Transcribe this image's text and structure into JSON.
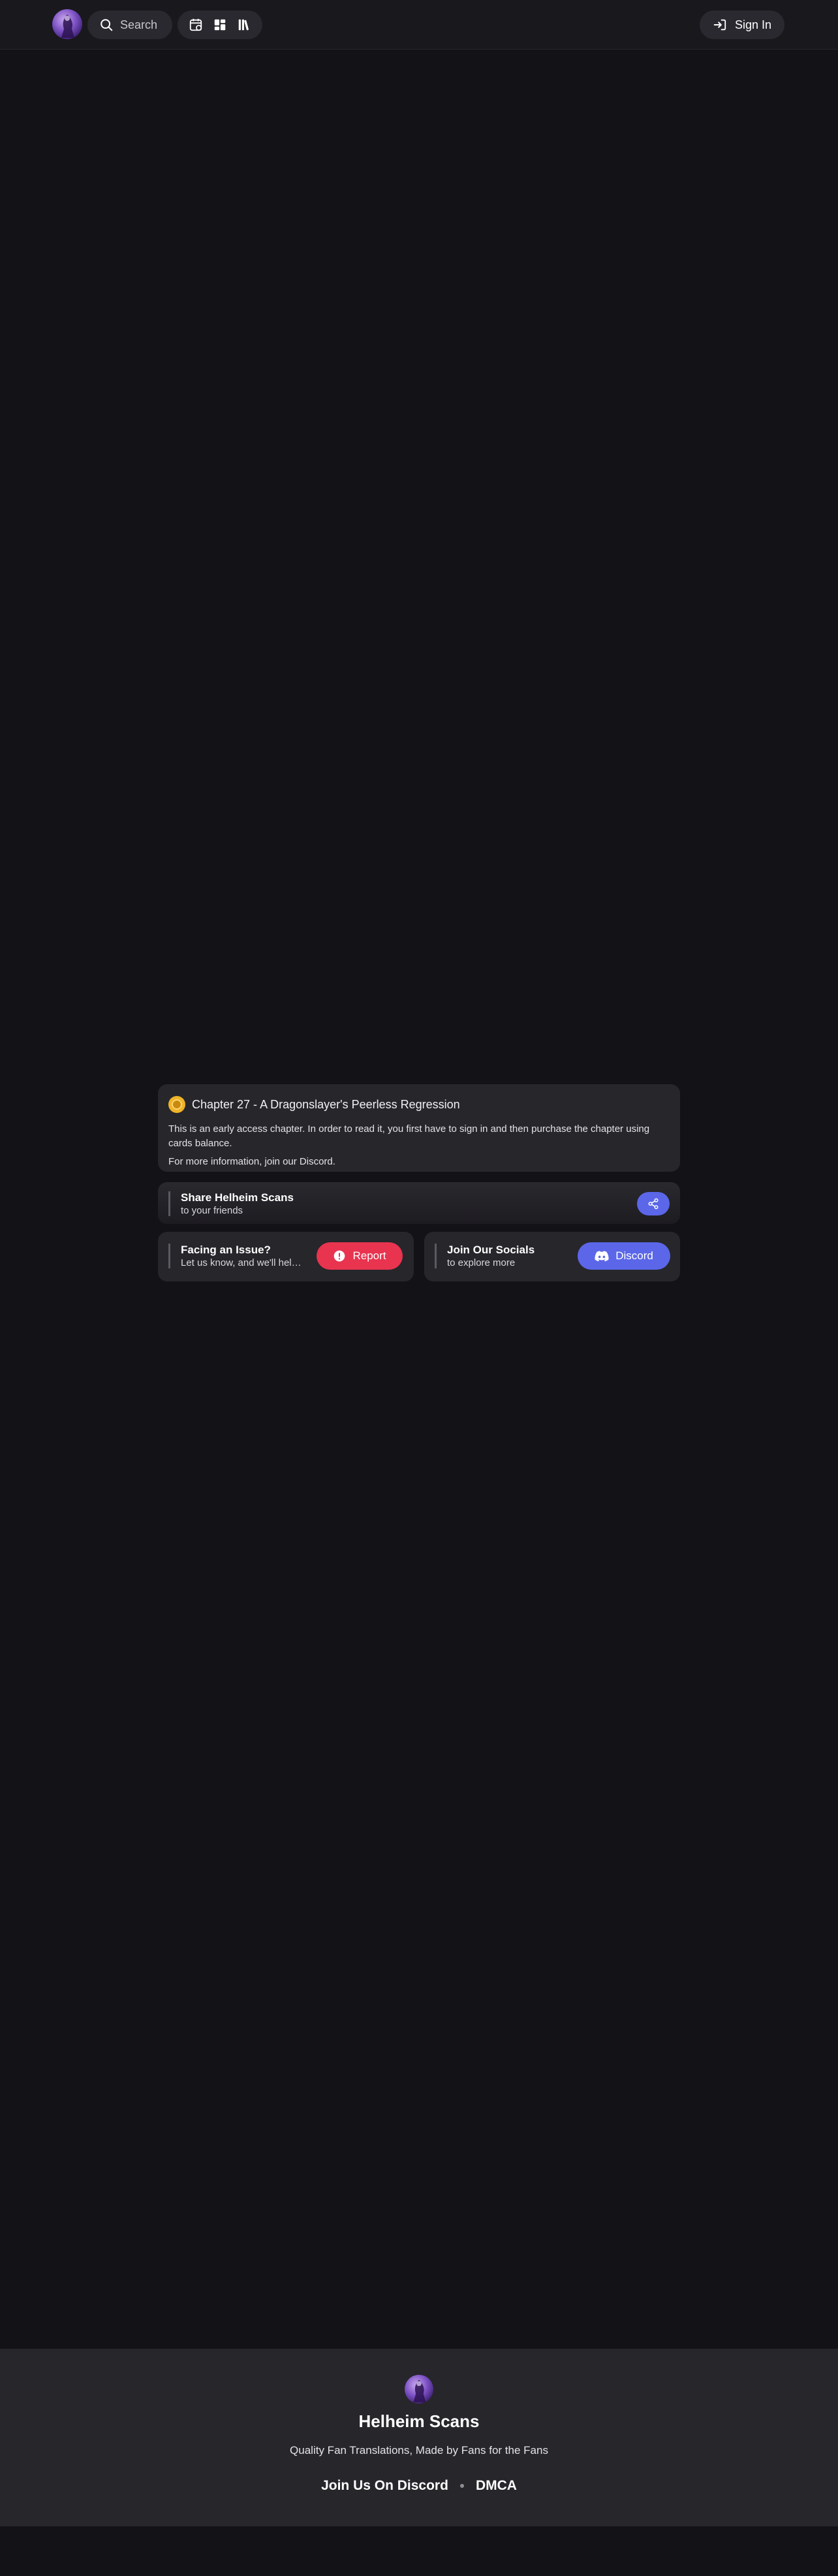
{
  "header": {
    "search_label": "Search",
    "signin_label": "Sign In",
    "nav_icons": [
      "calendar-icon",
      "dashboard-icon",
      "library-icon"
    ]
  },
  "early_access": {
    "title": "Chapter 27 - A Dragonslayer's Peerless Regression",
    "body": "This is an early access chapter. In order to read it, you first have to sign in and then purchase the chapter using cards balance.",
    "info": "For more information, join our Discord."
  },
  "share": {
    "title": "Share Helheim Scans",
    "subtitle": "to your friends"
  },
  "issue": {
    "title": "Facing an Issue?",
    "subtitle": "Let us know, and we'll help you",
    "button": "Report"
  },
  "socials": {
    "title": "Join Our Socials",
    "subtitle": "to explore more",
    "button": "Discord"
  },
  "footer": {
    "name": "Helheim Scans",
    "tagline": "Quality Fan Translations, Made by Fans for the Fans",
    "link_discord": "Join Us On Discord",
    "link_dmca": "DMCA"
  },
  "colors": {
    "background": "#131217",
    "card": "#27262b",
    "accent": "#5b67e8",
    "danger": "#e8344f",
    "coin": "#f0b429"
  }
}
